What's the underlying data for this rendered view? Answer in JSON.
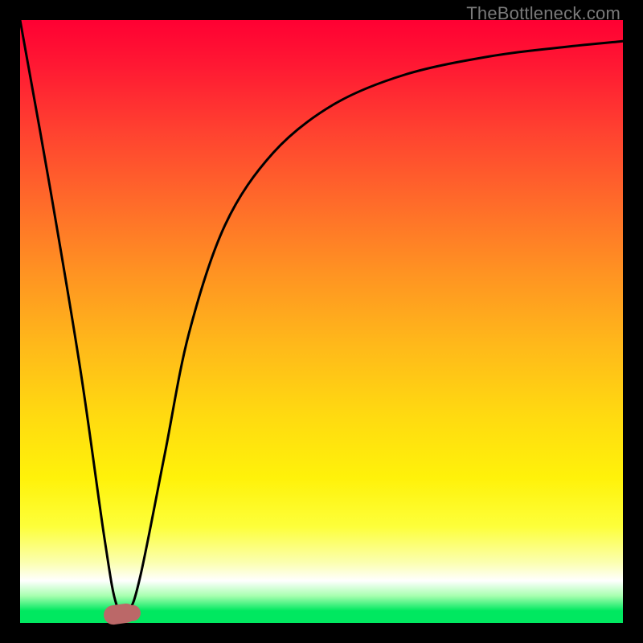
{
  "watermark": "TheBottleneck.com",
  "chart_data": {
    "type": "line",
    "title": "",
    "xlabel": "",
    "ylabel": "",
    "xlim": [
      0,
      100
    ],
    "ylim": [
      0,
      100
    ],
    "grid": false,
    "legend": false,
    "series": [
      {
        "name": "bottleneck-curve",
        "x": [
          0,
          5,
          10,
          14,
          16,
          18,
          20,
          24,
          28,
          34,
          42,
          52,
          64,
          78,
          90,
          100
        ],
        "values": [
          100,
          72,
          42,
          14,
          3,
          2,
          8,
          28,
          48,
          66,
          78,
          86,
          91,
          94,
          95.5,
          96.5
        ]
      }
    ],
    "annotations": [
      {
        "name": "optimal-marker",
        "x": 16.5,
        "y": 1.5,
        "color": "#bb6868"
      }
    ],
    "background_gradient": {
      "stops": [
        {
          "pos": 0,
          "color": "#ff0033"
        },
        {
          "pos": 0.3,
          "color": "#ff6a2a"
        },
        {
          "pos": 0.66,
          "color": "#ffdb10"
        },
        {
          "pos": 0.9,
          "color": "#fbffb0"
        },
        {
          "pos": 0.93,
          "color": "#ffffff"
        },
        {
          "pos": 1.0,
          "color": "#00e860"
        }
      ]
    }
  }
}
